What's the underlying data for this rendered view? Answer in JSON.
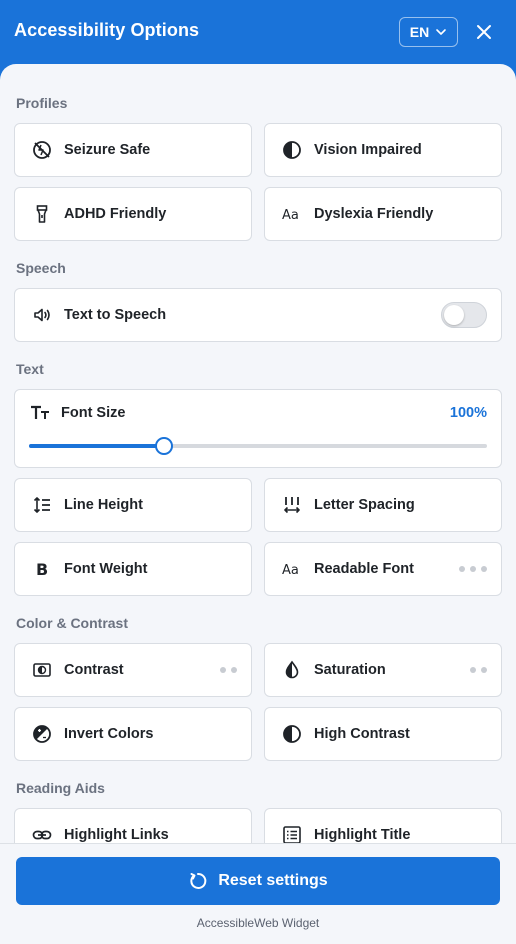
{
  "header": {
    "title": "Accessibility Options",
    "language": "EN",
    "accent_color": "#1a73d9"
  },
  "sections": {
    "profiles": "Profiles",
    "speech": "Speech",
    "text": "Text",
    "color_contrast": "Color & Contrast",
    "reading_aids": "Reading Aids"
  },
  "profiles": [
    {
      "label": "Seizure Safe",
      "icon": "seizure-safe-icon"
    },
    {
      "label": "Vision Impaired",
      "icon": "half-circle-icon"
    },
    {
      "label": "ADHD Friendly",
      "icon": "flashlight-icon"
    },
    {
      "label": "Dyslexia Friendly",
      "icon": "aa-icon"
    }
  ],
  "speech": {
    "text_to_speech": {
      "label": "Text to Speech",
      "icon": "speaker-icon",
      "enabled": false
    }
  },
  "text": {
    "font_size": {
      "label": "Font Size",
      "value": "100%",
      "slider_fraction": 0.295
    },
    "items": [
      {
        "label": "Line Height",
        "icon": "line-height-icon"
      },
      {
        "label": "Letter Spacing",
        "icon": "letter-spacing-icon"
      },
      {
        "label": "Font Weight",
        "icon": "bold-b-icon"
      },
      {
        "label": "Readable Font",
        "icon": "aa-icon",
        "step_dots": 3
      }
    ]
  },
  "color_contrast": [
    {
      "label": "Contrast",
      "icon": "contrast-icon",
      "step_dots": 2
    },
    {
      "label": "Saturation",
      "icon": "droplet-icon",
      "step_dots": 2
    },
    {
      "label": "Invert Colors",
      "icon": "invert-icon"
    },
    {
      "label": "High Contrast",
      "icon": "half-circle-icon"
    }
  ],
  "reading_aids": [
    {
      "label": "Highlight Links",
      "icon": "link-icon"
    },
    {
      "label": "Highlight Title",
      "icon": "list-icon"
    }
  ],
  "footer": {
    "reset_label": "Reset settings",
    "brand": "AccessibleWeb Widget"
  }
}
